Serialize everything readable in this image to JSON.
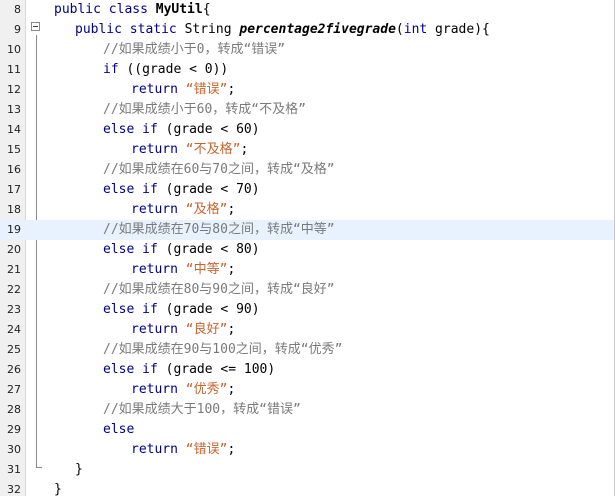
{
  "lines": [
    {
      "n": "8",
      "indent": 0,
      "parts": [
        [
          "kw",
          "public class "
        ],
        [
          "bold",
          "MyUtil"
        ],
        [
          "",
          "{"
        ]
      ]
    },
    {
      "n": "9",
      "indent": 1,
      "parts": [
        [
          "kw",
          "public static "
        ],
        [
          "",
          "String "
        ],
        [
          "fn",
          "percentage2fivegrade"
        ],
        [
          "",
          "("
        ],
        [
          "kw",
          "int"
        ],
        [
          "",
          " grade){"
        ]
      ]
    },
    {
      "n": "10",
      "indent": 2,
      "parts": [
        [
          "cm",
          "//如果成绩小于0，转成“错误”"
        ]
      ]
    },
    {
      "n": "11",
      "indent": 2,
      "parts": [
        [
          "kw",
          "if"
        ],
        [
          "",
          " ((grade < 0))"
        ]
      ]
    },
    {
      "n": "12",
      "indent": 3,
      "parts": [
        [
          "kw",
          "return "
        ],
        [
          "st",
          "“错误”"
        ],
        [
          "",
          ";"
        ]
      ]
    },
    {
      "n": "13",
      "indent": 2,
      "parts": [
        [
          "cm",
          "//如果成绩小于60，转成“不及格”"
        ]
      ]
    },
    {
      "n": "14",
      "indent": 2,
      "parts": [
        [
          "kw",
          "else if"
        ],
        [
          "",
          " (grade < 60)"
        ]
      ]
    },
    {
      "n": "15",
      "indent": 3,
      "parts": [
        [
          "kw",
          "return "
        ],
        [
          "st",
          "“不及格”"
        ],
        [
          "",
          ";"
        ]
      ]
    },
    {
      "n": "16",
      "indent": 2,
      "parts": [
        [
          "cm",
          "//如果成绩在60与70之间，转成“及格”"
        ]
      ]
    },
    {
      "n": "17",
      "indent": 2,
      "parts": [
        [
          "kw",
          "else if"
        ],
        [
          "",
          " (grade < 70)"
        ]
      ]
    },
    {
      "n": "18",
      "indent": 3,
      "parts": [
        [
          "kw",
          "return "
        ],
        [
          "st",
          "“及格”"
        ],
        [
          "",
          ";"
        ]
      ]
    },
    {
      "n": "19",
      "indent": 2,
      "hl": true,
      "parts": [
        [
          "cm",
          "//如果成绩在70与80之间，转成“中等”"
        ]
      ]
    },
    {
      "n": "20",
      "indent": 2,
      "parts": [
        [
          "kw",
          "else if"
        ],
        [
          "",
          " (grade < 80)"
        ]
      ]
    },
    {
      "n": "21",
      "indent": 3,
      "parts": [
        [
          "kw",
          "return "
        ],
        [
          "st",
          "“中等”"
        ],
        [
          "",
          ";"
        ]
      ]
    },
    {
      "n": "22",
      "indent": 2,
      "parts": [
        [
          "cm",
          "//如果成绩在80与90之间，转成“良好”"
        ]
      ]
    },
    {
      "n": "23",
      "indent": 2,
      "parts": [
        [
          "kw",
          "else if"
        ],
        [
          "",
          " (grade < 90)"
        ]
      ]
    },
    {
      "n": "24",
      "indent": 3,
      "parts": [
        [
          "kw",
          "return "
        ],
        [
          "st",
          "“良好”"
        ],
        [
          "",
          ";"
        ]
      ]
    },
    {
      "n": "25",
      "indent": 2,
      "parts": [
        [
          "cm",
          "//如果成绩在90与100之间，转成“优秀”"
        ]
      ]
    },
    {
      "n": "26",
      "indent": 2,
      "parts": [
        [
          "kw",
          "else if"
        ],
        [
          "",
          " (grade <= 100)"
        ]
      ]
    },
    {
      "n": "27",
      "indent": 3,
      "parts": [
        [
          "kw",
          "return "
        ],
        [
          "st",
          "“优秀”"
        ],
        [
          "",
          ";"
        ]
      ]
    },
    {
      "n": "28",
      "indent": 2,
      "parts": [
        [
          "cm",
          "//如果成绩大于100，转成“错误”"
        ]
      ]
    },
    {
      "n": "29",
      "indent": 2,
      "parts": [
        [
          "kw",
          "else"
        ]
      ]
    },
    {
      "n": "30",
      "indent": 3,
      "parts": [
        [
          "kw",
          "return "
        ],
        [
          "st",
          "“错误”"
        ],
        [
          "",
          ";"
        ]
      ]
    },
    {
      "n": "31",
      "indent": 1,
      "parts": [
        [
          "",
          "}"
        ]
      ]
    },
    {
      "n": "32",
      "indent": 0,
      "parts": [
        [
          "",
          "}"
        ]
      ]
    }
  ]
}
